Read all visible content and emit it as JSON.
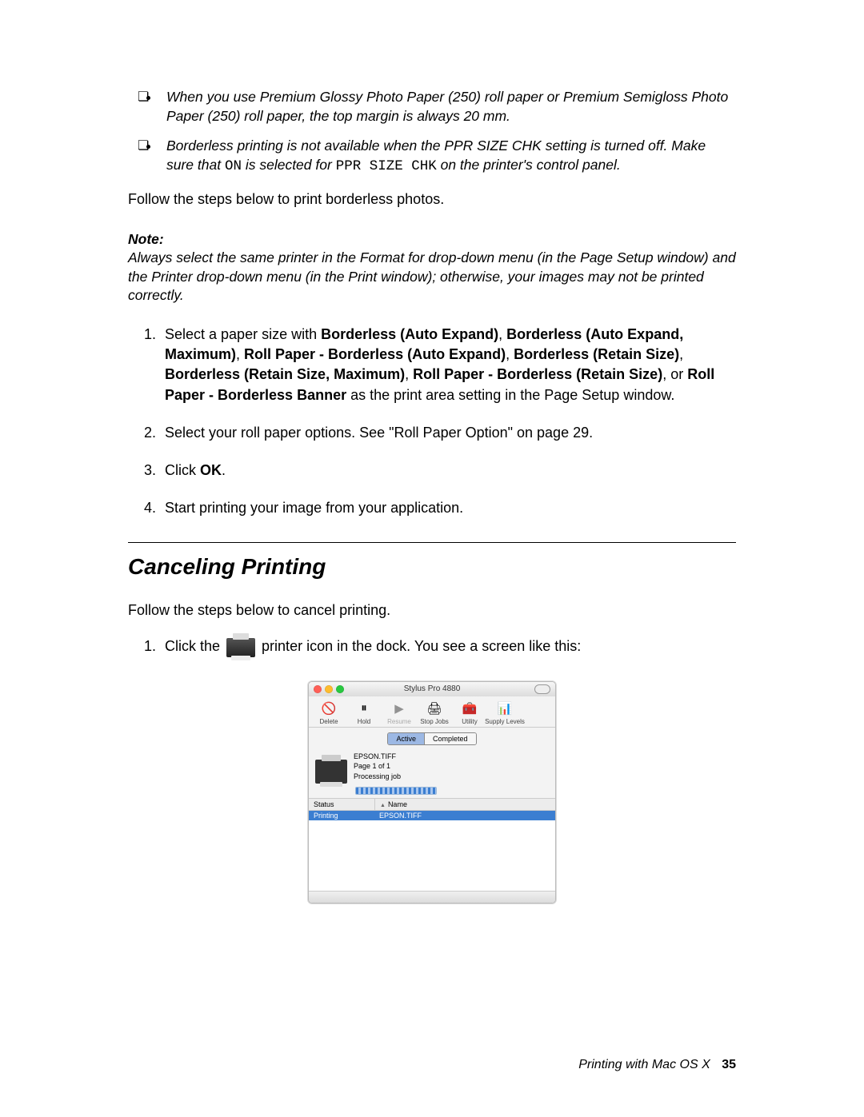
{
  "bullets": {
    "b1": "When you use Premium Glossy Photo Paper (250) roll paper or Premium Semigloss Photo Paper (250) roll paper, the top margin is always 20 mm.",
    "b2a": "Borderless printing is not available when the PPR SIZE CHK setting is turned off. Make sure that ",
    "b2_on": "ON",
    "b2b": " is selected for ",
    "b2_mono": "PPR SIZE CHK",
    "b2c": " on the printer's control panel."
  },
  "intro": "Follow the steps below to print borderless photos.",
  "note": {
    "label": "Note:",
    "text": "Always select the same printer in the Format for drop-down menu (in the Page Setup window) and the Printer drop-down menu (in the Print window); otherwise, your images may not be printed correctly."
  },
  "steps": {
    "s1_a": "Select a paper size with ",
    "s1_opt1": "Borderless (Auto Expand)",
    "s1_c1": ", ",
    "s1_opt2": "Borderless (Auto Expand, Maximum)",
    "s1_c2": ", ",
    "s1_opt3": "Roll Paper - Borderless (Auto Expand)",
    "s1_c3": ", ",
    "s1_opt4": "Borderless (Retain Size)",
    "s1_c4": ", ",
    "s1_opt5": "Borderless (Retain Size, Maximum)",
    "s1_c5": ", ",
    "s1_opt6": "Roll Paper - Borderless (Retain Size)",
    "s1_c6": ", or ",
    "s1_opt7": "Roll Paper - Borderless Banner",
    "s1_b": " as the print area setting in the Page Setup window.",
    "s2": "Select your roll paper options. See \"Roll Paper Option\" on page 29.",
    "s3a": "Click ",
    "s3b": "OK",
    "s3c": ".",
    "s4": "Start printing your image from your application."
  },
  "heading": "Canceling Printing",
  "intro2": "Follow the steps below to cancel printing.",
  "cancel_step_a": "Click the ",
  "cancel_step_b": " printer icon in the dock. You see a screen like this:",
  "window": {
    "title": "Stylus Pro 4880",
    "toolbar": {
      "delete": "Delete",
      "hold": "Hold",
      "resume": "Resume",
      "stopjobs": "Stop Jobs",
      "utility": "Utility",
      "supply": "Supply Levels"
    },
    "tabs": {
      "active": "Active",
      "completed": "Completed"
    },
    "job": {
      "file": "EPSON.TIFF",
      "page": "Page 1 of 1",
      "status": "Processing job"
    },
    "list": {
      "status_hdr": "Status",
      "name_hdr": "Name",
      "row_status": "Printing",
      "row_name": "EPSON.TIFF"
    }
  },
  "footer": {
    "text": "Printing with Mac OS X",
    "page": "35"
  }
}
